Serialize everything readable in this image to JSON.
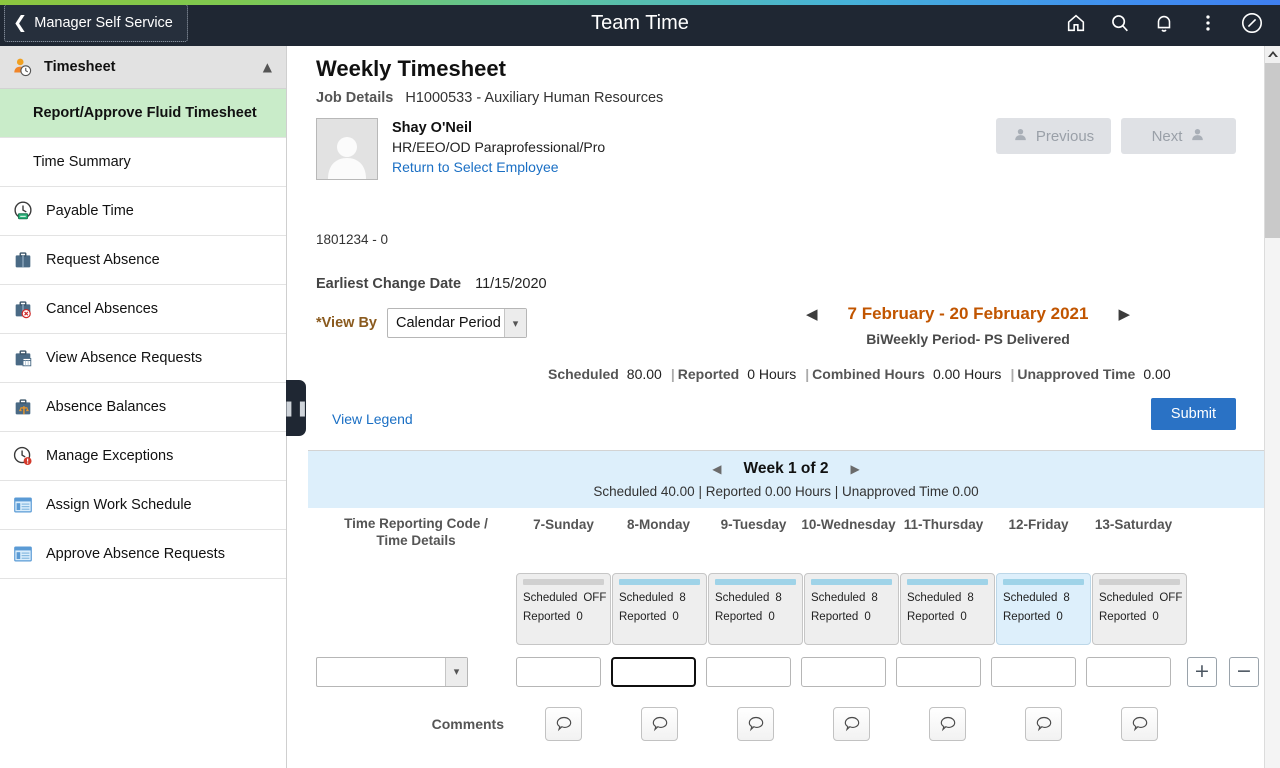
{
  "header": {
    "back_label": "Manager Self Service",
    "title": "Team Time",
    "icons": [
      "home-icon",
      "search-icon",
      "notifications-bell-icon",
      "actions-kebab-icon",
      "navbar-compass-icon"
    ]
  },
  "sidebar": {
    "section": {
      "label": "Timesheet",
      "icon": "person-clock-icon"
    },
    "items": [
      {
        "label": "Report/Approve Fluid Timesheet",
        "icon": null,
        "selected": true
      },
      {
        "label": "Time Summary",
        "icon": null,
        "selected": false
      },
      {
        "label": "Payable Time",
        "icon": "clock-money-icon",
        "selected": false
      },
      {
        "label": "Request Absence",
        "icon": "briefcase-icon",
        "selected": false
      },
      {
        "label": "Cancel Absences",
        "icon": "briefcase-cancel-icon",
        "selected": false
      },
      {
        "label": "View Absence Requests",
        "icon": "briefcase-calendar-icon",
        "selected": false
      },
      {
        "label": "Absence Balances",
        "icon": "briefcase-balance-icon",
        "selected": false
      },
      {
        "label": "Manage Exceptions",
        "icon": "clock-alert-icon",
        "selected": false
      },
      {
        "label": "Assign Work Schedule",
        "icon": "schedule-window-icon",
        "selected": false
      },
      {
        "label": "Approve Absence Requests",
        "icon": "schedule-window-icon",
        "selected": false
      }
    ]
  },
  "page": {
    "title": "Weekly Timesheet",
    "job_details_label": "Job Details",
    "job_details_value": "H1000533 - Auxiliary Human Resources",
    "employee": {
      "name": "Shay  O'Neil",
      "job_title": "HR/EEO/OD Paraprofessional/Pro",
      "return_link": "Return to Select Employee",
      "id": "1801234 - 0"
    },
    "previous_label": "Previous",
    "next_label": "Next",
    "earliest_change_label": "Earliest Change Date",
    "earliest_change_value": "11/15/2020",
    "view_by_label": "*View By",
    "view_by_value": "Calendar Period",
    "period_label": "7 February - 20 February 2021",
    "period_sub": "BiWeekly Period- PS Delivered",
    "totals": {
      "scheduled_label": "Scheduled",
      "scheduled_value": "80.00",
      "reported_label": "Reported",
      "reported_value": "0 Hours",
      "combined_label": "Combined Hours",
      "combined_value": "0.00 Hours",
      "unapproved_label": "Unapproved Time",
      "unapproved_value": "0.00"
    },
    "view_legend": "View Legend",
    "submit_label": "Submit"
  },
  "week": {
    "label": "Week 1 of 2",
    "totals": "Scheduled  40.00 | Reported  0.00 Hours | Unapproved Time  0.00"
  },
  "grid": {
    "trc_header": "Time Reporting Code / Time Details",
    "trc_header_line1": "Time Reporting Code /",
    "trc_header_line2": "Time Details",
    "comments_label": "Comments",
    "trc_value": "",
    "plus_label": "+",
    "minus_label": "−",
    "days": [
      {
        "header": "7-Sunday",
        "scheduled_label": "Scheduled",
        "scheduled_value": "OFF",
        "reported_label": "Reported",
        "reported_value": "0",
        "off": true,
        "highlight": false,
        "input_value": "",
        "error": false
      },
      {
        "header": "8-Monday",
        "scheduled_label": "Scheduled",
        "scheduled_value": "8",
        "reported_label": "Reported",
        "reported_value": "0",
        "off": false,
        "highlight": false,
        "input_value": "",
        "error": true
      },
      {
        "header": "9-Tuesday",
        "scheduled_label": "Scheduled",
        "scheduled_value": "8",
        "reported_label": "Reported",
        "reported_value": "0",
        "off": false,
        "highlight": false,
        "input_value": "",
        "error": false
      },
      {
        "header": "10-Wednesday",
        "scheduled_label": "Scheduled",
        "scheduled_value": "8",
        "reported_label": "Reported",
        "reported_value": "0",
        "off": false,
        "highlight": false,
        "input_value": "",
        "error": false
      },
      {
        "header": "11-Thursday",
        "scheduled_label": "Scheduled",
        "scheduled_value": "8",
        "reported_label": "Reported",
        "reported_value": "0",
        "off": false,
        "highlight": false,
        "input_value": "",
        "error": false
      },
      {
        "header": "12-Friday",
        "scheduled_label": "Scheduled",
        "scheduled_value": "8",
        "reported_label": "Reported",
        "reported_value": "0",
        "off": false,
        "highlight": true,
        "input_value": "",
        "error": false
      },
      {
        "header": "13-Saturday",
        "scheduled_label": "Scheduled",
        "scheduled_value": "OFF",
        "reported_label": "Reported",
        "reported_value": "0",
        "off": true,
        "highlight": false,
        "input_value": "",
        "error": false
      }
    ]
  },
  "colors": {
    "header_bg": "#1f2733",
    "selected_nav": "#c9ecc9",
    "accent_orange": "#c15500",
    "submit_blue": "#2a72c5",
    "link_blue": "#1a6fc4",
    "band_blue": "#ddeffb",
    "error_red": "#d9261c"
  }
}
